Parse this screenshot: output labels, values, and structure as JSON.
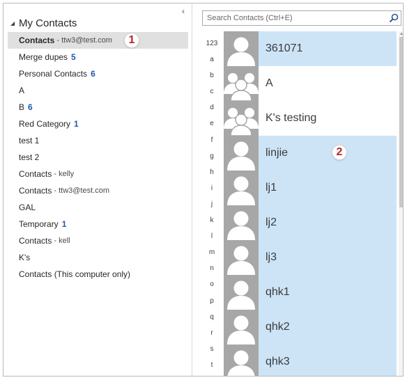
{
  "folder_pane": {
    "collapse_glyph": "‹",
    "tree_title": "My Contacts",
    "folders": [
      {
        "label": "Contacts",
        "account": "- ttw3@test.com",
        "count": "",
        "selected": true
      },
      {
        "label": "Merge dupes",
        "account": "",
        "count": "5"
      },
      {
        "label": "Personal Contacts",
        "account": "",
        "count": "6"
      },
      {
        "label": "A",
        "account": "",
        "count": ""
      },
      {
        "label": "B",
        "account": "",
        "count": "6"
      },
      {
        "label": "Red Category",
        "account": "",
        "count": "1"
      },
      {
        "label": "test 1",
        "account": "",
        "count": ""
      },
      {
        "label": "test 2",
        "account": "",
        "count": ""
      },
      {
        "label": "Contacts",
        "account": "- kelly",
        "count": ""
      },
      {
        "label": "Contacts",
        "account": "- ttw3@test.com",
        "count": ""
      },
      {
        "label": "GAL",
        "account": "",
        "count": ""
      },
      {
        "label": "Temporary",
        "account": "",
        "count": "1"
      },
      {
        "label": "Contacts",
        "account": "- kell",
        "count": ""
      },
      {
        "label": "K's",
        "account": "",
        "count": ""
      },
      {
        "label": "Contacts (This computer only)",
        "account": "",
        "count": ""
      }
    ],
    "callout_number": "1"
  },
  "contact_pane": {
    "search": {
      "placeholder": "Search Contacts (Ctrl+E)",
      "icon": "search-icon"
    },
    "alpha_index": [
      "123",
      "a",
      "b",
      "c",
      "d",
      "e",
      "f",
      "g",
      "h",
      "i",
      "j",
      "k",
      "l",
      "m",
      "n",
      "o",
      "p",
      "q",
      "r",
      "s",
      "t"
    ],
    "contacts": [
      {
        "name": "361071",
        "selected": true,
        "avatar": "person"
      },
      {
        "name": "A",
        "selected": false,
        "avatar": "group"
      },
      {
        "name": "K's testing",
        "selected": false,
        "avatar": "group"
      },
      {
        "name": "linjie",
        "selected": true,
        "avatar": "person"
      },
      {
        "name": "lj1",
        "selected": true,
        "avatar": "person"
      },
      {
        "name": "lj2",
        "selected": true,
        "avatar": "person"
      },
      {
        "name": "lj3",
        "selected": true,
        "avatar": "person"
      },
      {
        "name": "qhk1",
        "selected": true,
        "avatar": "person"
      },
      {
        "name": "qhk2",
        "selected": true,
        "avatar": "person"
      },
      {
        "name": "qhk3",
        "selected": true,
        "avatar": "person"
      }
    ],
    "callout_number": "2"
  },
  "colors": {
    "selection": "#cde4f7",
    "folder_selected": "#e0e0e0",
    "count_blue": "#1e5aa8",
    "callout_red": "#b3262b",
    "avatar_gray": "#a7a7a7"
  }
}
